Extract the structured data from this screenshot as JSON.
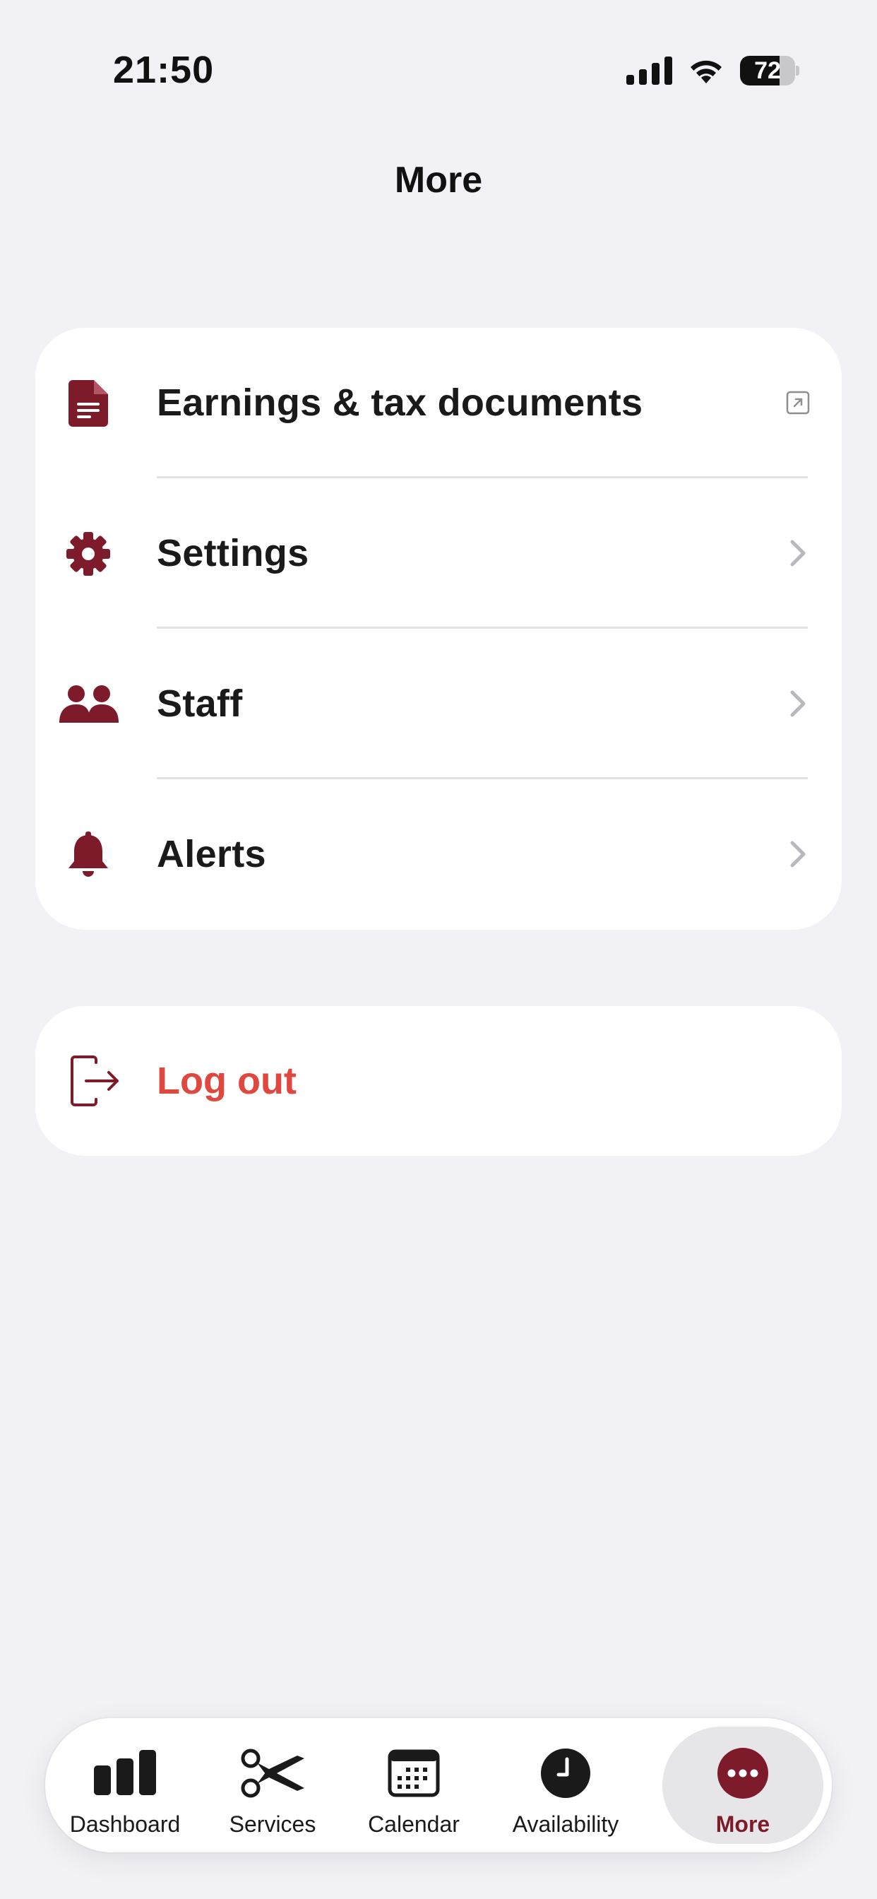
{
  "status_bar": {
    "time": "21:50",
    "battery_level": "72",
    "battery_fraction": 0.72,
    "icons": [
      "signal-icon",
      "wifi-icon",
      "battery-icon"
    ]
  },
  "header": {
    "title": "More"
  },
  "menu": {
    "items": [
      {
        "label": "Earnings & tax documents",
        "icon": "document-icon",
        "trailing": "external-link-icon"
      },
      {
        "label": "Settings",
        "icon": "gear-icon",
        "trailing": "chevron-right-icon"
      },
      {
        "label": "Staff",
        "icon": "people-icon",
        "trailing": "chevron-right-icon"
      },
      {
        "label": "Alerts",
        "icon": "bell-icon",
        "trailing": "chevron-right-icon"
      }
    ]
  },
  "logout": {
    "label": "Log out",
    "icon": "logout-icon"
  },
  "tab_bar": {
    "tabs": [
      {
        "label": "Dashboard",
        "icon": "bar-chart-icon",
        "active": false
      },
      {
        "label": "Services",
        "icon": "scissors-icon",
        "active": false
      },
      {
        "label": "Calendar",
        "icon": "calendar-icon",
        "active": false
      },
      {
        "label": "Availability",
        "icon": "clock-icon",
        "active": false
      },
      {
        "label": "More",
        "icon": "more-icon",
        "active": true
      }
    ]
  },
  "colors": {
    "accent": "#7e1b2b",
    "logout": "#e0473f",
    "background": "#f2f1f6",
    "card": "#ffffff"
  }
}
